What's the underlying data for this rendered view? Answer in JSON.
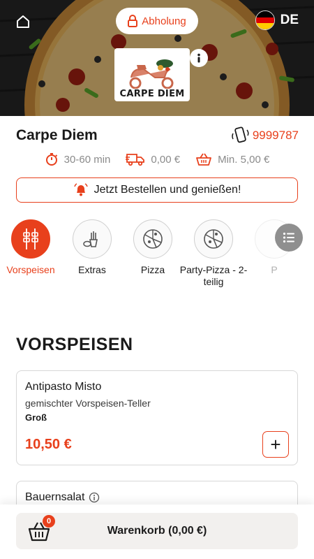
{
  "header": {
    "pickup_label": "Abholung",
    "language": "DE",
    "logo_text": "CARPE DIEM"
  },
  "restaurant": {
    "name": "Carpe Diem",
    "phone": "9999787",
    "delivery_time": "30-60 min",
    "delivery_fee": "0,00 €",
    "minimum_order": "Min. 5,00 €",
    "order_banner": "Jetzt Bestellen und genießen!"
  },
  "categories": [
    {
      "label": "Vorspeisen",
      "active": true
    },
    {
      "label": "Extras",
      "active": false
    },
    {
      "label": "Pizza",
      "active": false
    },
    {
      "label": "Party-Pizza - 2-teilig",
      "active": false
    },
    {
      "label": "P",
      "active": false
    }
  ],
  "section": {
    "title": "VORSPEISEN"
  },
  "items": [
    {
      "name": "Antipasto Misto",
      "description": "gemischter Vorspeisen-Teller",
      "size": "Groß",
      "price": "10,50 €",
      "add_label": "+"
    },
    {
      "name": "Bauernsalat"
    }
  ],
  "cart": {
    "count": "0",
    "label": "Warenkorb (0,00 €)"
  },
  "colors": {
    "accent": "#e8401c",
    "cart_bg": "#f2f0ee",
    "muted": "#8a8a8a"
  }
}
